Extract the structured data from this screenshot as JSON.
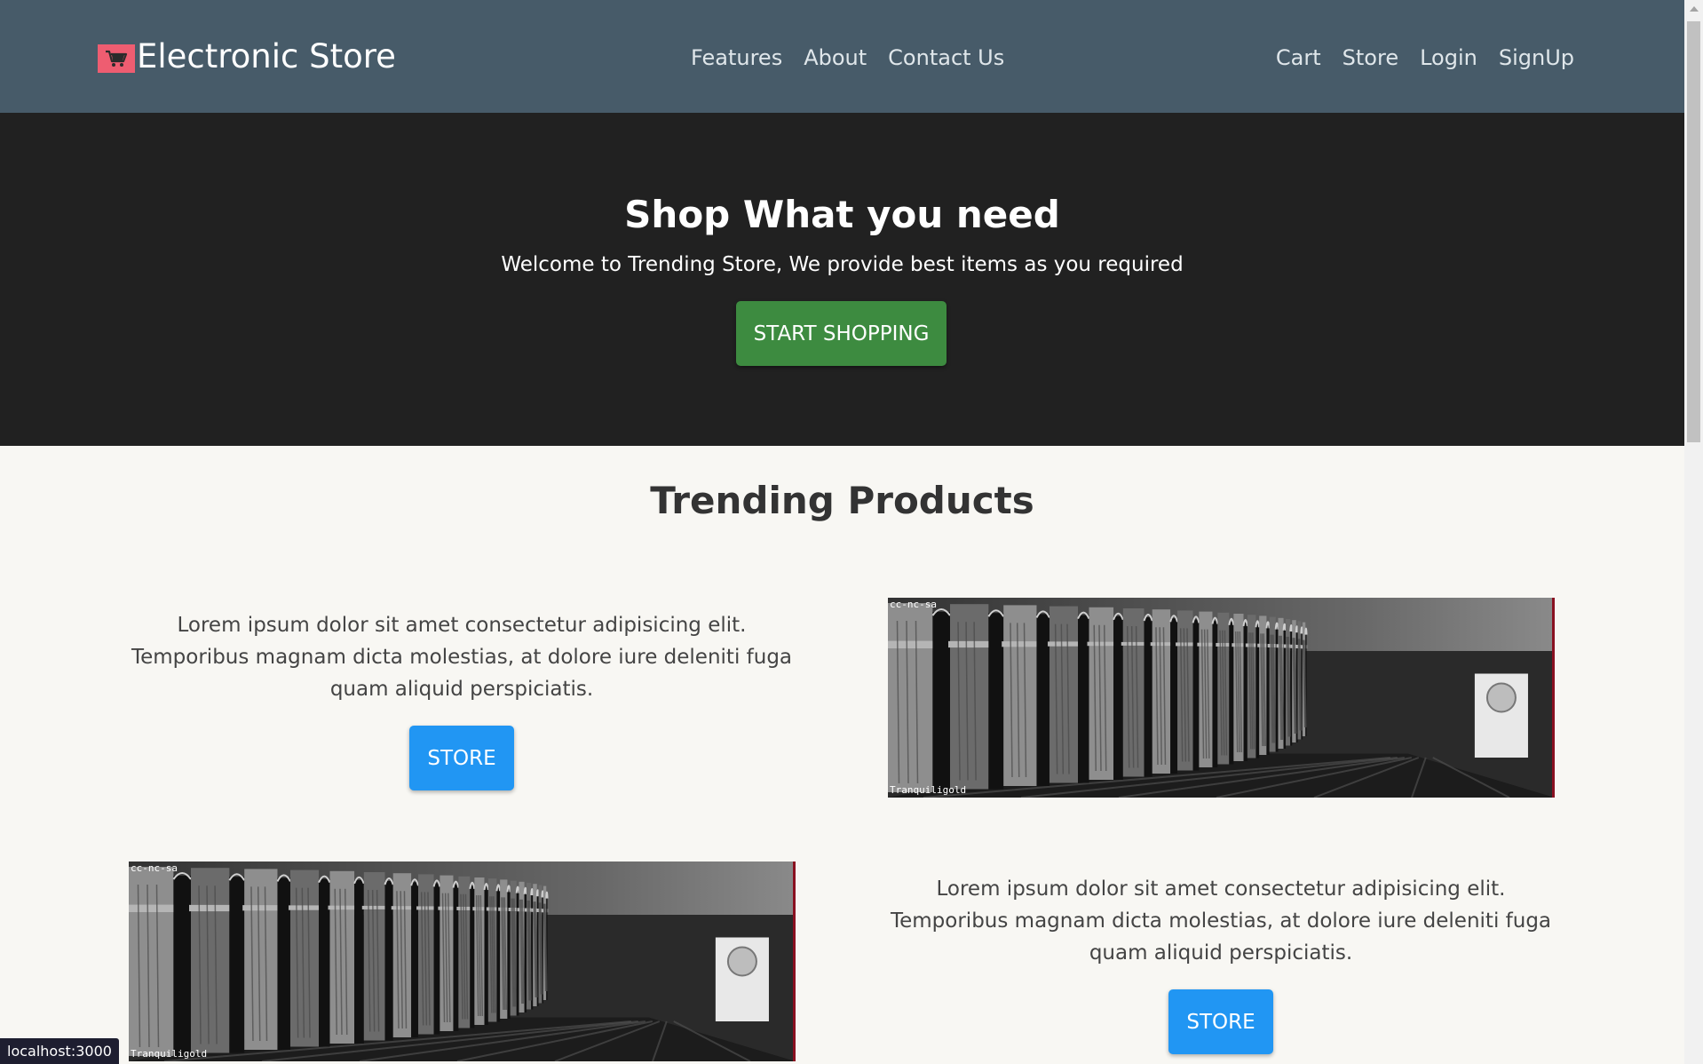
{
  "navbar": {
    "brand": "Electronic Store",
    "center_links": [
      "Features",
      "About",
      "Contact Us"
    ],
    "right_links": [
      "Cart",
      "Store",
      "Login",
      "SignUp"
    ]
  },
  "hero": {
    "title": "Shop What you need",
    "subtitle": "Welcome to Trending Store, We provide best items as you required",
    "button": "START SHOPPING"
  },
  "trending": {
    "title": "Trending Products",
    "products": [
      {
        "description": "Lorem ipsum dolor sit amet consectetur adipisicing elit. Temporibus magnam dicta molestias, at dolore iure deleniti fuga quam aliquid perspiciatis.",
        "button": "STORE",
        "image_license": "cc-nc-sa",
        "image_credit": "Tranquiligold"
      },
      {
        "description": "Lorem ipsum dolor sit amet consectetur adipisicing elit. Temporibus magnam dicta molestias, at dolore iure deleniti fuga quam aliquid perspiciatis.",
        "button": "STORE",
        "image_license": "cc-nc-sa",
        "image_credit": "Tranquiligold"
      }
    ]
  },
  "status_bar": {
    "url": "localhost:3000"
  },
  "colors": {
    "navbar": "#475b69",
    "hero": "#212121",
    "start_button": "#3d8b40",
    "store_button": "#2196f3",
    "logo": "#ee5d71"
  }
}
